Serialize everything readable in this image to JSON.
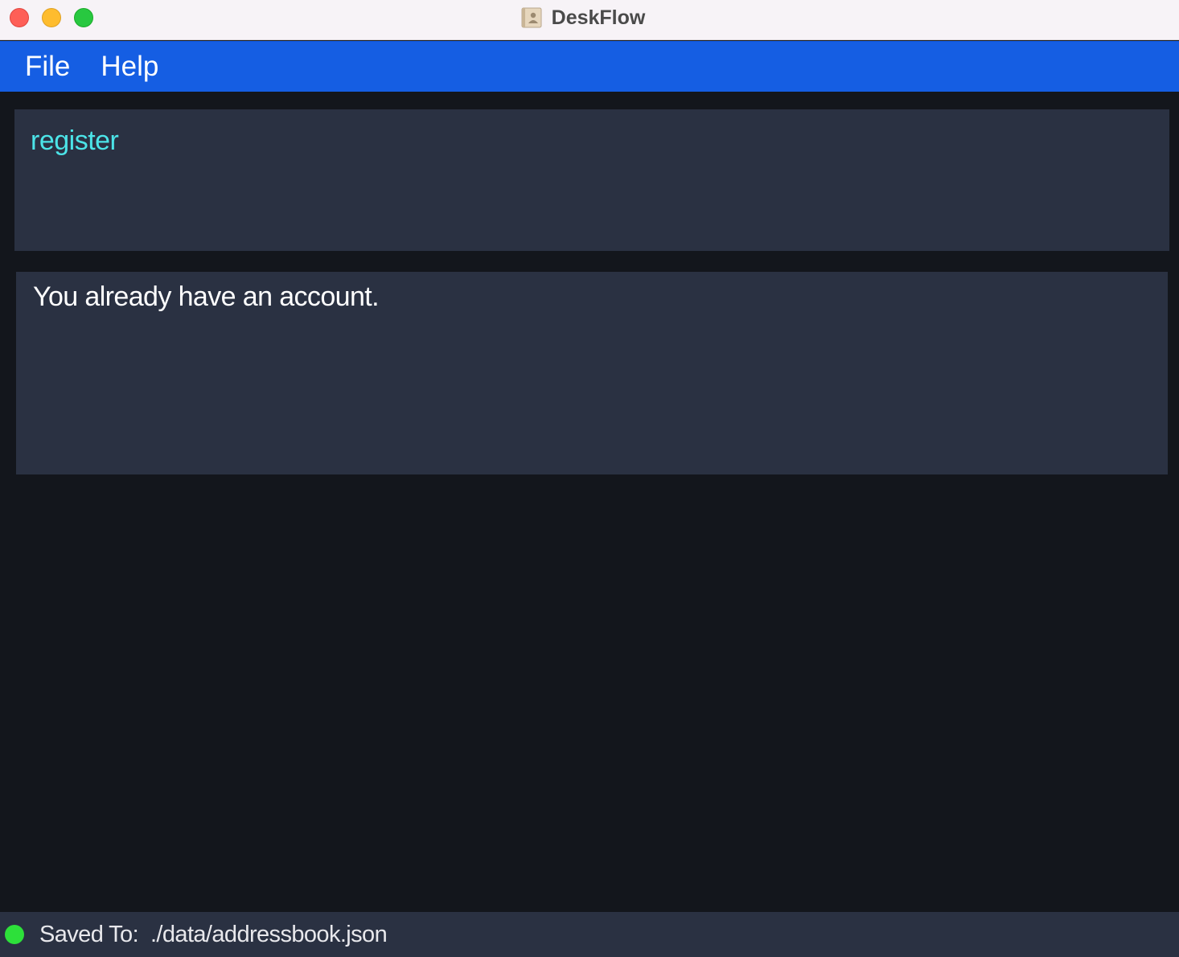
{
  "window": {
    "title": "DeskFlow",
    "app_icon": "address-book-icon"
  },
  "menu": {
    "items": [
      {
        "label": "File"
      },
      {
        "label": "Help"
      }
    ]
  },
  "command": {
    "value": "register"
  },
  "result": {
    "message": "You already have an account."
  },
  "status": {
    "label": "Saved To:",
    "path": "./data/addressbook.json",
    "indicator_color": "#2de03a"
  },
  "colors": {
    "menubar": "#155ee3",
    "panel": "#2a3142",
    "background": "#13161c",
    "command_text": "#4ce4e8"
  }
}
